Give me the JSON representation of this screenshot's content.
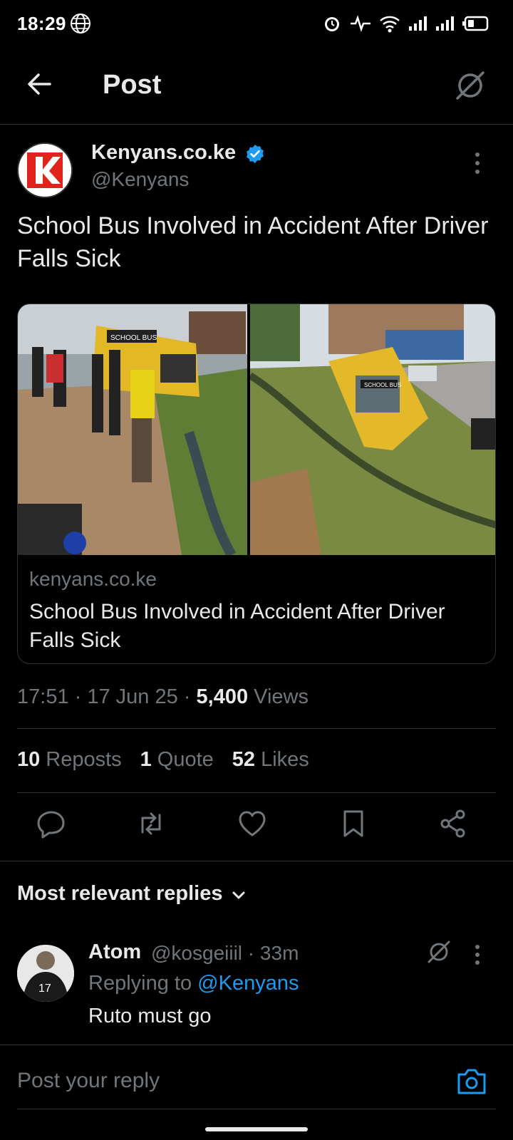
{
  "status_bar": {
    "time": "18:29"
  },
  "header": {
    "title": "Post"
  },
  "post": {
    "author_name": "Kenyans.co.ke",
    "author_handle": "@Kenyans",
    "text": "School Bus Involved in Accident After Driver Falls Sick",
    "card": {
      "domain": "kenyans.co.ke",
      "title": "School Bus Involved in Accident After Driver Falls Sick",
      "image_left_label": "SCHOOL BUS",
      "image_right_label": "SCHOOL BUS"
    },
    "time": "17:51",
    "date": "17 Jun 25",
    "views_count": "5,400",
    "views_label": "Views",
    "reposts_count": "10",
    "reposts_label": "Reposts",
    "quotes_count": "1",
    "quotes_label": "Quote",
    "likes_count": "52",
    "likes_label": "Likes"
  },
  "replies": {
    "filter_label": "Most relevant replies",
    "items": [
      {
        "name": "Atom",
        "handle": "@kosgeiiil",
        "age": "33m",
        "replying_to_label": "Replying to",
        "replying_to_handle": "@Kenyans",
        "text": "Ruto must go"
      }
    ]
  },
  "composer": {
    "placeholder": "Post your reply"
  },
  "colors": {
    "accent": "#1d9bf0",
    "background": "#000000",
    "muted": "#71767b",
    "border": "#2f3336"
  }
}
